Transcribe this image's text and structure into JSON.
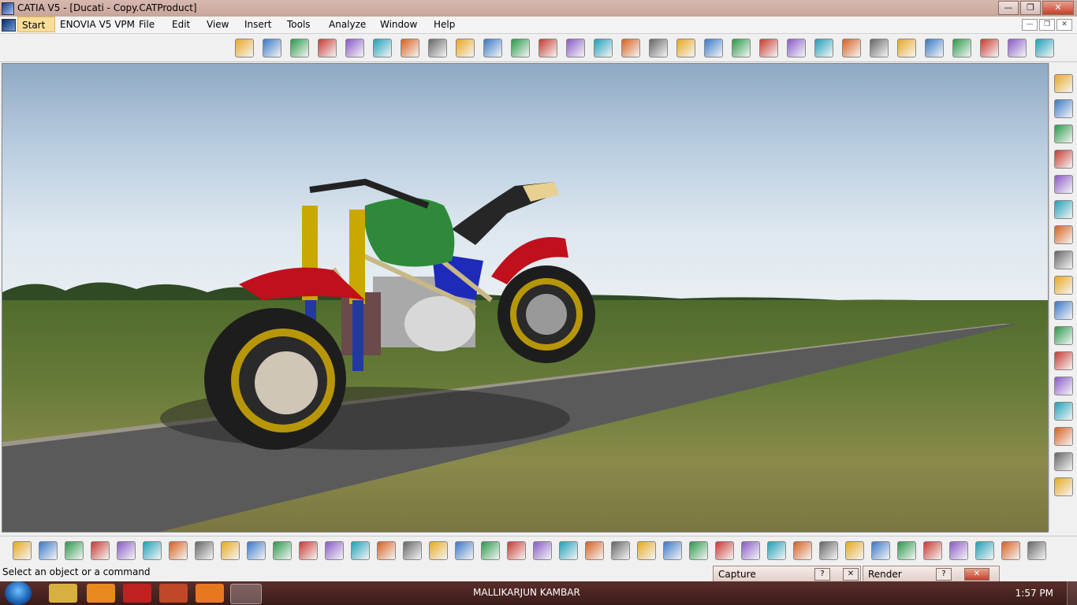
{
  "window": {
    "title": "CATIA V5 - [Ducati - Copy.CATProduct]",
    "buttons": {
      "minimize": "—",
      "maximize": "❐",
      "close": "✕"
    }
  },
  "menubar": {
    "items": [
      "Start",
      "ENOVIA V5 VPM",
      "File",
      "Edit",
      "View",
      "Insert",
      "Tools",
      "Analyze",
      "Window",
      "Help"
    ]
  },
  "mdi": {
    "minimize": "—",
    "restore": "❐",
    "close": "✕"
  },
  "status": {
    "text": "Select an object or a command"
  },
  "panels": {
    "capture": {
      "label": "Capture",
      "help": "?",
      "close": "✕"
    },
    "render": {
      "label": "Render",
      "help": "?",
      "close": "✕"
    }
  },
  "taskbar": {
    "user": "MALLIKARJUN KAMBAR",
    "time": "1:57 PM"
  },
  "colors": {
    "titlebar": "#c9a59b",
    "start_highlight": "#f8dc9a",
    "taskbar": "#3a1c1a"
  },
  "icons": {
    "top_toolbar": [
      "catalog-icon",
      "sphere-icon",
      "tools-icon",
      "product-icon",
      "component-icon",
      "part-icon",
      "bring-icon",
      "replace-icon",
      "refresh-icon",
      "snap-icon",
      "explode-icon",
      "stop-icon",
      "clash-icon",
      "measure-icon",
      "annotation-icon",
      "flag-icon",
      "view-icon",
      "section-icon",
      "constraint-icon",
      "fix-icon",
      "contact-icon",
      "offset-icon",
      "angle-icon",
      "coincidence-icon",
      "ref-icon",
      "update-icon",
      "catalog2-icon",
      "reorder-icon",
      "multi-icon",
      "publish-icon"
    ],
    "right_toolbar": [
      "gear-icon",
      "page-icon",
      "page-icon",
      "page-icon",
      "page-icon",
      "cursor-icon",
      "cursor2-icon",
      "link-icon",
      "cube-icon",
      "pan-icon",
      "plane-icon",
      "anchor-icon",
      "pen-icon",
      "group-icon",
      "chain-icon",
      "swap-icon",
      "settings-icon"
    ],
    "bottom_toolbar": [
      "new-icon",
      "open-icon",
      "save-icon",
      "print-icon",
      "cut-icon",
      "copy-icon",
      "paste-icon",
      "undo-icon",
      "redo-icon",
      "whats-this-icon",
      "formula-icon",
      "chat-icon",
      "light-icon",
      "grid-icon",
      "tree-icon",
      "lock-icon",
      "spec-icon",
      "fly-icon",
      "fit-icon",
      "pan-icon",
      "rotate-icon",
      "zoom-in-icon",
      "zoom-out-icon",
      "normal-view-icon",
      "iso-view-icon",
      "views-icon",
      "render-icon",
      "shading-icon",
      "hide-icon",
      "swap-icon",
      "measure-icon",
      "snap-icon",
      "camera-icon",
      "capture-icon",
      "dimension-icon",
      "robot-icon",
      "bottle-icon",
      "eraser-icon",
      "grid2-icon",
      "catalog-icon"
    ],
    "taskbar": [
      "windows-start-icon",
      "explorer-icon",
      "media-icon",
      "pdf-icon",
      "word-icon",
      "vlc-icon",
      "catia-icon"
    ]
  }
}
